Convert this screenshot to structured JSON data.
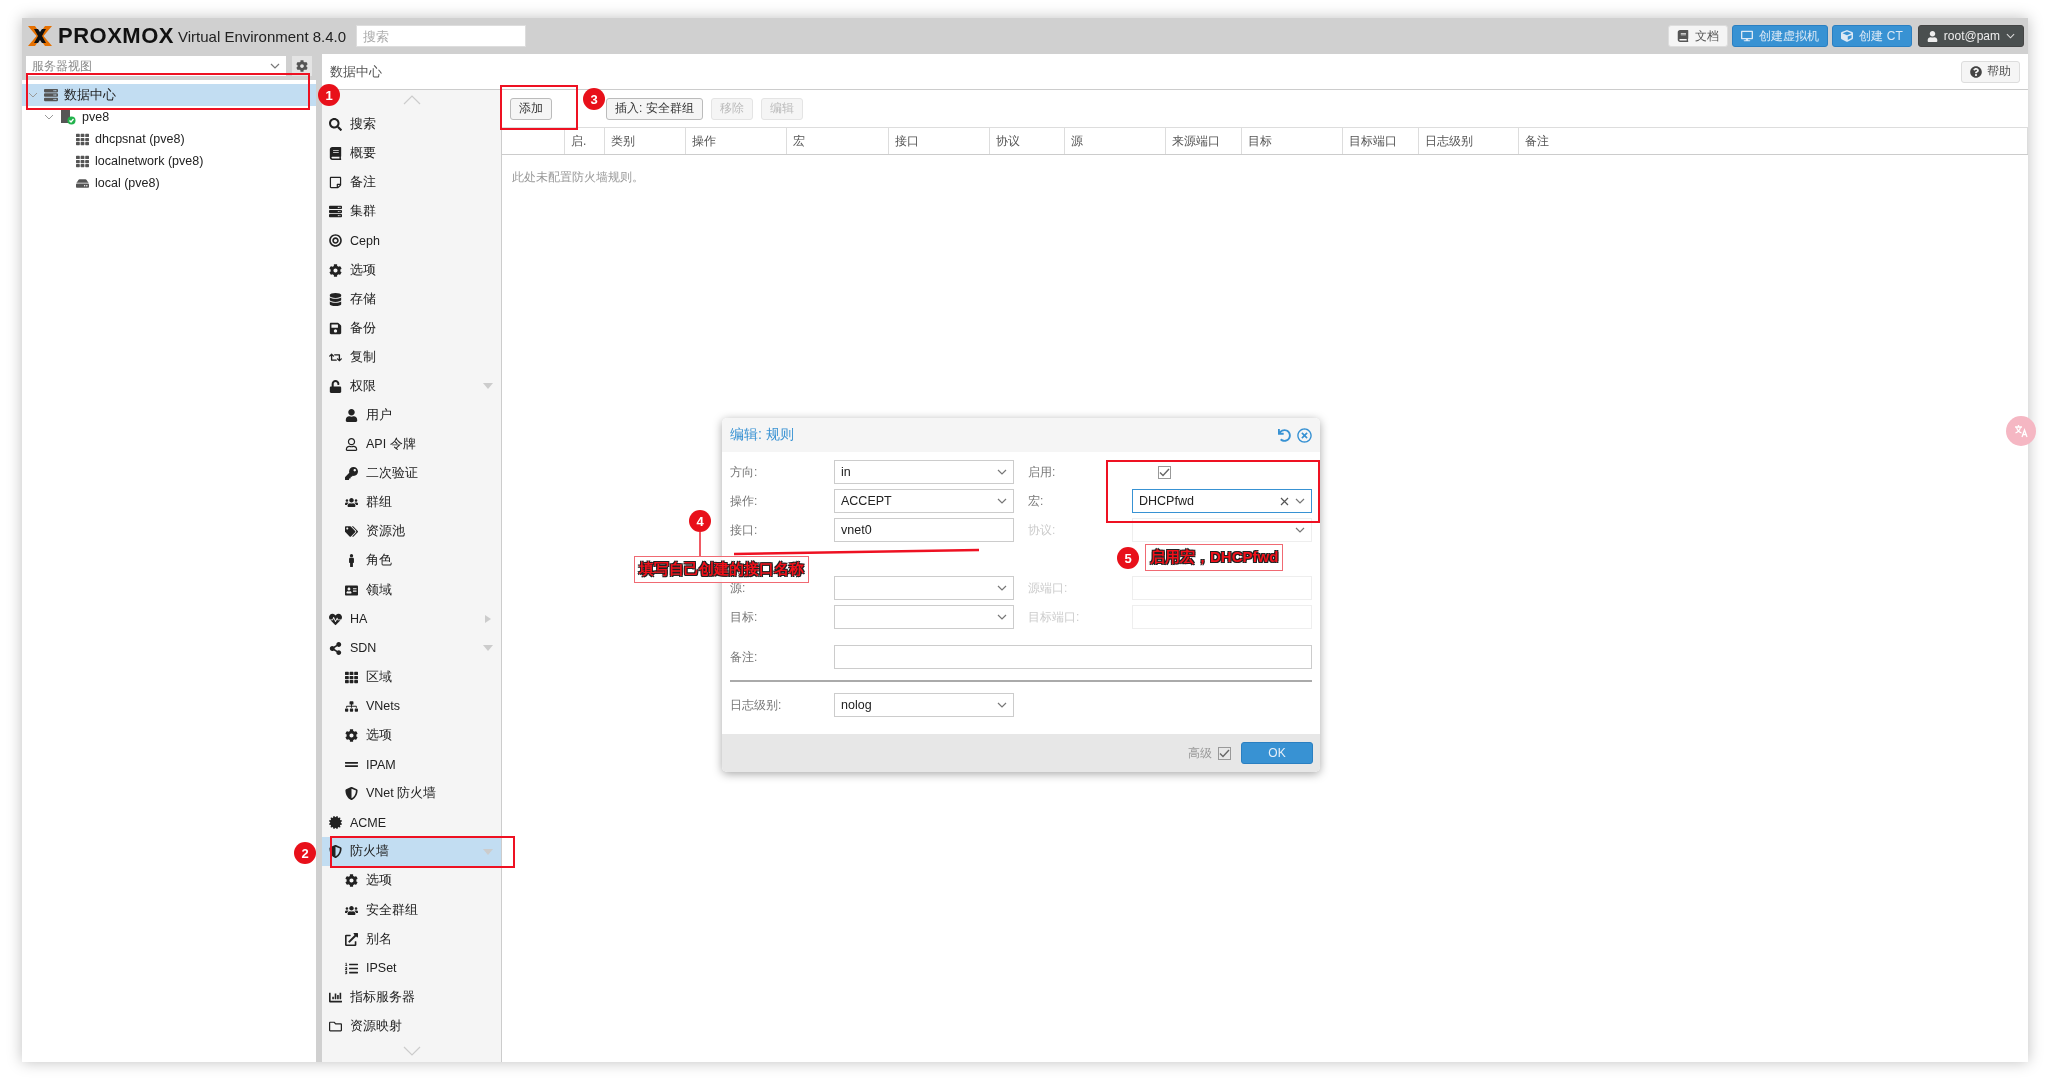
{
  "header": {
    "logo": "PROXMOX",
    "product": "Virtual Environment 8.4.0",
    "search": {
      "placeholder": "搜索"
    },
    "buttons": [
      {
        "label": "文档",
        "kind": "plain"
      },
      {
        "label": "创建虚拟机",
        "kind": "primary"
      },
      {
        "label": "创建 CT",
        "kind": "primary"
      },
      {
        "label": "root@pam",
        "kind": "user"
      }
    ]
  },
  "sidebar": {
    "view": "服务器视图",
    "tree": [
      {
        "label": "数据中心",
        "selected": true,
        "expanded": true,
        "children": [
          {
            "label": "pve8",
            "selected": false,
            "expanded": true,
            "children": [
              {
                "label": "dhcpsnat (pve8)",
                "selected": false
              },
              {
                "label": "localnetwork (pve8)",
                "selected": false
              },
              {
                "label": "local (pve8)",
                "selected": false
              }
            ]
          }
        ]
      }
    ]
  },
  "breadcrumb": "数据中心",
  "help": "帮助",
  "menu": [
    {
      "label": "搜索",
      "selected": false
    },
    {
      "label": "概要",
      "selected": false
    },
    {
      "label": "备注",
      "selected": false
    },
    {
      "label": "集群",
      "selected": false
    },
    {
      "label": "Ceph",
      "selected": false
    },
    {
      "label": "选项",
      "selected": false
    },
    {
      "label": "存储",
      "selected": false
    },
    {
      "label": "备份",
      "selected": false
    },
    {
      "label": "复制",
      "selected": false
    },
    {
      "label": "权限",
      "selected": false,
      "expanded": true,
      "children": [
        {
          "label": "用户",
          "selected": false
        },
        {
          "label": "API 令牌",
          "selected": false
        },
        {
          "label": "二次验证",
          "selected": false
        },
        {
          "label": "群组",
          "selected": false
        },
        {
          "label": "资源池",
          "selected": false
        },
        {
          "label": "角色",
          "selected": false
        },
        {
          "label": "领域",
          "selected": false
        }
      ]
    },
    {
      "label": "HA",
      "selected": false,
      "expanded": false
    },
    {
      "label": "SDN",
      "selected": false,
      "expanded": true,
      "children": [
        {
          "label": "区域",
          "selected": false
        },
        {
          "label": "VNets",
          "selected": false
        },
        {
          "label": "选项",
          "selected": false
        },
        {
          "label": "IPAM",
          "selected": false
        },
        {
          "label": "VNet 防火墙",
          "selected": false
        }
      ]
    },
    {
      "label": "ACME",
      "selected": false
    },
    {
      "label": "防火墙",
      "selected": true,
      "expanded": true,
      "children": [
        {
          "label": "选项",
          "selected": false
        },
        {
          "label": "安全群组",
          "selected": false
        },
        {
          "label": "别名",
          "selected": false
        },
        {
          "label": "IPSet",
          "selected": false
        }
      ]
    },
    {
      "label": "指标服务器",
      "selected": false
    },
    {
      "label": "资源映射",
      "selected": false
    }
  ],
  "toolbar": [
    {
      "label": "添加",
      "disabled": false
    },
    {
      "label": "插入: 安全群组",
      "disabled": false
    },
    {
      "label": "移除",
      "disabled": true
    },
    {
      "label": "编辑",
      "disabled": true
    }
  ],
  "table": {
    "columns": [
      "",
      "启.",
      "类别",
      "操作",
      "宏",
      "接口",
      "协议",
      "源",
      "来源端口",
      "目标",
      "目标端口",
      "日志级别",
      "备注"
    ],
    "empty_text": "此处未配置防火墙规则。"
  },
  "dialog": {
    "title": "编辑: 规则",
    "field_groups": [
      [
        {
          "left": {
            "label": "方向:",
            "kind": "combo",
            "value": "in",
            "disabled": false
          },
          "right": {
            "label": "启用:",
            "kind": "checkbox",
            "checked": true,
            "disabled": false
          }
        },
        {
          "left": {
            "label": "操作:",
            "kind": "combo",
            "value": "ACCEPT",
            "disabled": false
          },
          "right": {
            "label": "宏:",
            "kind": "combo",
            "value": "DHCPfwd",
            "disabled": false,
            "focused": true,
            "clearable": true
          }
        },
        {
          "left": {
            "label": "接口:",
            "kind": "text",
            "value": "vnet0",
            "disabled": false
          },
          "right": {
            "label": "协议:",
            "kind": "combo",
            "disabled": true
          }
        }
      ],
      [
        {
          "left": {
            "label": "源:",
            "kind": "combo",
            "disabled": false
          },
          "right": {
            "label": "源端口:",
            "kind": "text",
            "disabled": true
          }
        },
        {
          "left": {
            "label": "目标:",
            "kind": "combo",
            "disabled": false
          },
          "right": {
            "label": "目标端口:",
            "kind": "text",
            "disabled": true
          }
        }
      ]
    ],
    "comment": {
      "label": "备注:",
      "kind": "text"
    },
    "log": {
      "label": "日志级别:",
      "kind": "combo",
      "value": "nolog"
    },
    "advanced": {
      "label": "高级",
      "checked": true
    },
    "ok": "OK"
  },
  "annotations": {
    "badges": [
      "1",
      "2",
      "3",
      "4",
      "5"
    ],
    "notes": [
      "填写自己创建的接口名称",
      "启用宏，DHCPfwd"
    ]
  }
}
